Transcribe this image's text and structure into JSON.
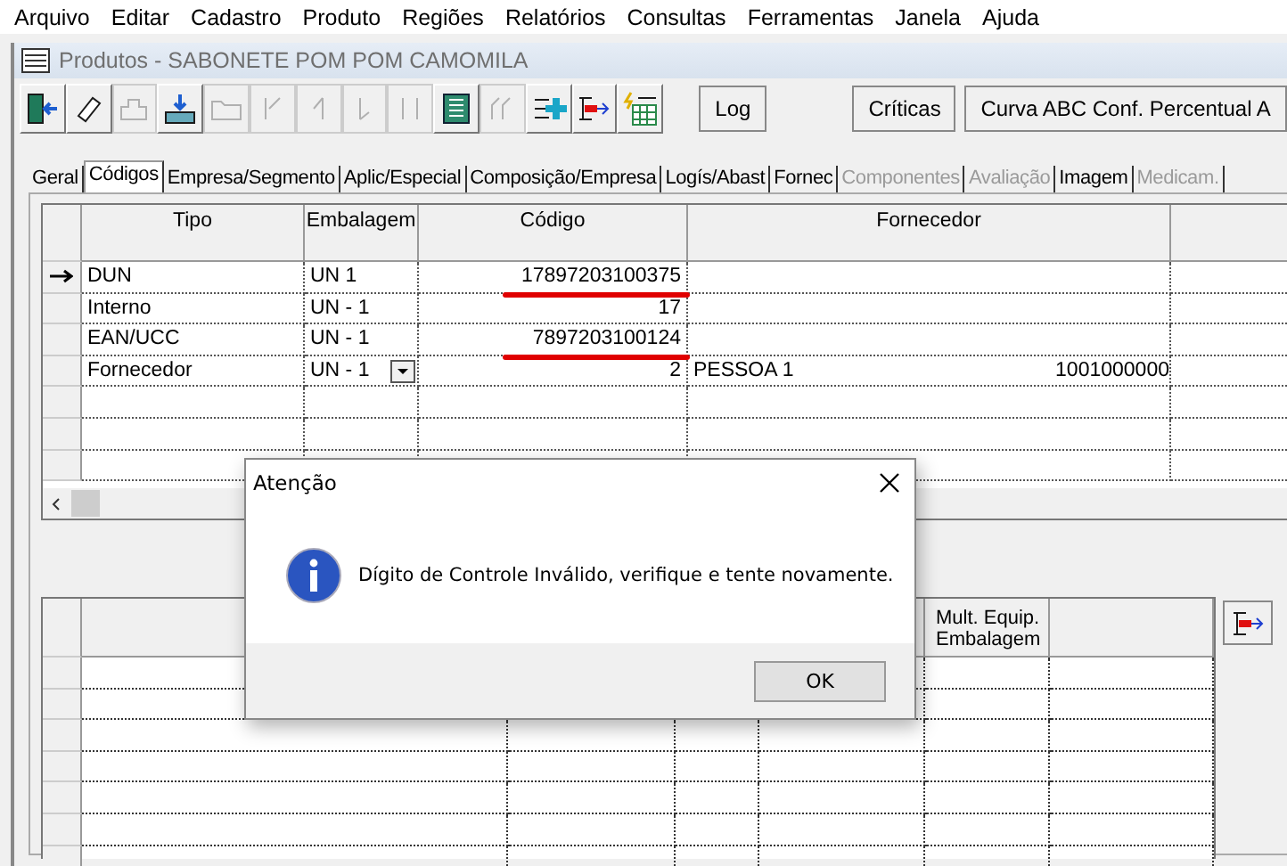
{
  "menu": [
    "Arquivo",
    "Editar",
    "Cadastro",
    "Produto",
    "Regiões",
    "Relatórios",
    "Consultas",
    "Ferramentas",
    "Janela",
    "Ajuda"
  ],
  "window": {
    "title": "Produtos - SABONETE POM POM CAMOMILA"
  },
  "toolbar": [
    {
      "kind": "exit",
      "disabled": false
    },
    {
      "kind": "eraser",
      "disabled": false
    },
    {
      "kind": "copy",
      "disabled": true
    },
    {
      "kind": "import",
      "disabled": false
    },
    {
      "kind": "folder",
      "disabled": true
    },
    {
      "kind": "first",
      "disabled": true
    },
    {
      "kind": "prev",
      "disabled": true
    },
    {
      "kind": "next",
      "disabled": true
    },
    {
      "kind": "last",
      "disabled": true
    },
    {
      "kind": "grid",
      "disabled": false
    },
    {
      "kind": "steps",
      "disabled": true
    },
    {
      "kind": "add",
      "disabled": false
    },
    {
      "kind": "remove",
      "disabled": false
    },
    {
      "kind": "calc",
      "disabled": false
    }
  ],
  "text_buttons": [
    "Log",
    "Críticas",
    "Curva ABC Conf. Percentual A"
  ],
  "tabs": [
    {
      "label": "Geral",
      "selected": false,
      "disabled": false
    },
    {
      "label": "Códigos",
      "selected": true,
      "disabled": false
    },
    {
      "label": "Empresa/Segmento",
      "selected": false,
      "disabled": false
    },
    {
      "label": "Aplic/Especial",
      "selected": false,
      "disabled": false
    },
    {
      "label": "Composição/Empresa",
      "selected": false,
      "disabled": false
    },
    {
      "label": "Logís/Abast",
      "selected": false,
      "disabled": false
    },
    {
      "label": "Fornec",
      "selected": false,
      "disabled": false
    },
    {
      "label": "Componentes",
      "selected": false,
      "disabled": true
    },
    {
      "label": "Avaliação",
      "selected": false,
      "disabled": true
    },
    {
      "label": "Imagem",
      "selected": false,
      "disabled": false
    },
    {
      "label": "Medicam.",
      "selected": false,
      "disabled": true
    }
  ],
  "codes_table": {
    "columns": [
      "Tipo",
      "Embalagem",
      "Código",
      "Fornecedor"
    ],
    "rows": [
      {
        "current": true,
        "tipo": "DUN",
        "embalagem": "UN  1",
        "codigo": "17897203100375",
        "underlined": true,
        "dropdown": false
      },
      {
        "current": false,
        "tipo": "Interno",
        "embalagem": "UN - 1",
        "codigo": "17",
        "underlined": false,
        "dropdown": false
      },
      {
        "current": false,
        "tipo": "EAN/UCC",
        "embalagem": "UN - 1",
        "codigo": "7897203100124",
        "underlined": true,
        "dropdown": false
      },
      {
        "current": false,
        "tipo": "Fornecedor",
        "embalagem": "UN - 1",
        "codigo": "2",
        "underlined": false,
        "dropdown": true,
        "fornecedor": "PESSOA 1",
        "fornecedor_code": "1001000000"
      }
    ]
  },
  "packaging_table": {
    "columns": [
      "Mult. Equip. Embalagem"
    ]
  },
  "dialog": {
    "title": "Atenção",
    "message": "Dígito de Controle Inválido, verifique e tente novamente.",
    "button": "OK"
  }
}
